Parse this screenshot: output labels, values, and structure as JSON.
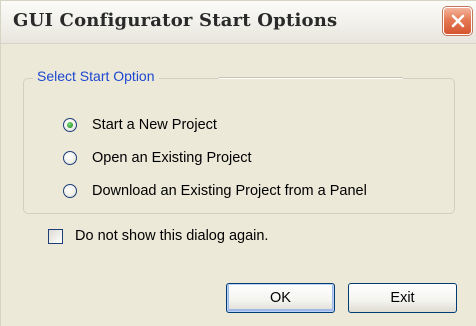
{
  "window": {
    "title": "GUI Configurator Start Options",
    "close_icon": "close-icon"
  },
  "group": {
    "legend": "Select Start Option",
    "options": [
      {
        "label": "Start a New Project",
        "selected": true
      },
      {
        "label": "Open an Existing Project",
        "selected": false
      },
      {
        "label": "Download an Existing Project from a Panel",
        "selected": false
      }
    ]
  },
  "checkbox": {
    "label": "Do not show this dialog again.",
    "checked": false
  },
  "buttons": {
    "ok_label": "OK",
    "exit_label": "Exit"
  },
  "colors": {
    "legend_text": "#1d48d0",
    "dialog_bg": "#ece9d8",
    "close_button": "#d5562f",
    "radio_dot": "#2f9c2f"
  }
}
